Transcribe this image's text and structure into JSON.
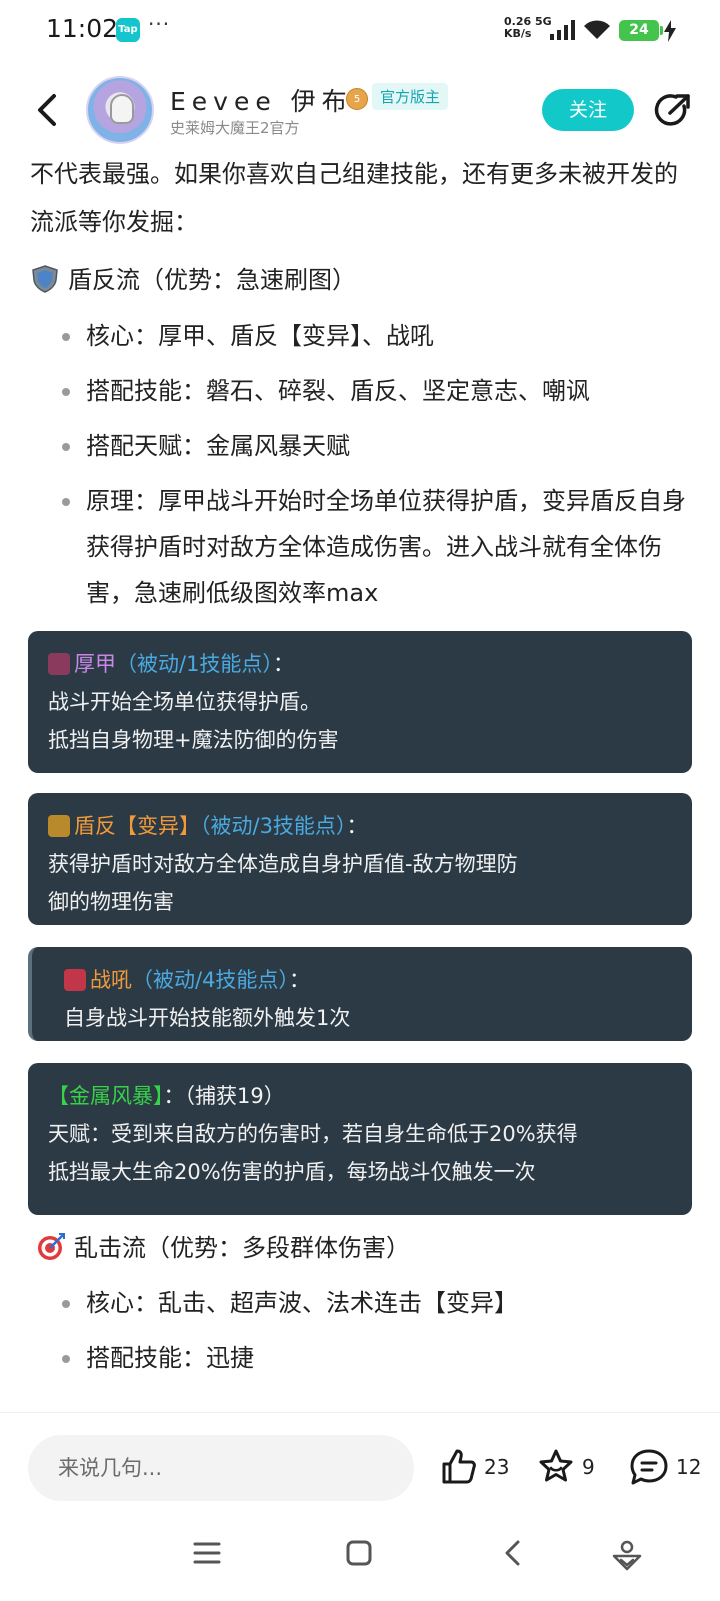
{
  "status": {
    "time": "11:02",
    "app_badge": "Tap",
    "more": "···",
    "net_speed_top": "0.26 5G",
    "net_speed_bottom": "KB/s",
    "battery": "24"
  },
  "header": {
    "user_name": "Eevee 伊布",
    "level": "5",
    "official_tag": "官方版主",
    "subtitle": "史莱姆大魔王2官方",
    "follow_label": "关注"
  },
  "intro": "不代表最强。如果你喜欢自己组建技能，还有更多未被开发的流派等你发掘：",
  "section1": {
    "heading": "盾反流（优势：急速刷图）",
    "bullets": [
      "核心：厚甲、盾反【变异】、战吼",
      "搭配技能：磐石、碎裂、盾反、坚定意志、嘲讽",
      "搭配天赋：金属风暴天赋",
      "原理：厚甲战斗开始时全场单位获得护盾，变异盾反自身获得护盾时对敌方全体造成伤害。进入战斗就有全体伤害，急速刷低级图效率max"
    ]
  },
  "cards": [
    {
      "name": "厚甲",
      "type": "（被动/1技能点）",
      "colon": "：",
      "lines": [
        "战斗开始全场单位获得护盾。",
        "抵挡自身物理+魔法防御的伤害"
      ]
    },
    {
      "name": "盾反【变异】",
      "type": "（被动/3技能点）",
      "colon": "：",
      "lines": [
        "获得护盾时对敌方全体造成自身护盾值-敌方物理防",
        "御的物理伤害"
      ]
    },
    {
      "name": "战吼",
      "type": "（被动/4技能点）",
      "colon": "：",
      "lines": [
        "自身战斗开始技能额外触发1次"
      ]
    },
    {
      "name": "【金属风暴】",
      "type": "：",
      "colon": "（捕获19）",
      "lines": [
        "天赋：受到来自敌方的伤害时，若自身生命低于20%获得",
        "抵挡最大生命20%伤害的护盾，每场战斗仅触发一次"
      ]
    }
  ],
  "section2": {
    "heading": "乱击流（优势：多段群体伤害）",
    "bullets": [
      "核心：乱击、超声波、法术连击【变异】",
      "搭配技能：迅捷"
    ]
  },
  "bottom": {
    "comment_placeholder": "来说几句...",
    "likes": "23",
    "favorites": "9",
    "comments": "12"
  }
}
